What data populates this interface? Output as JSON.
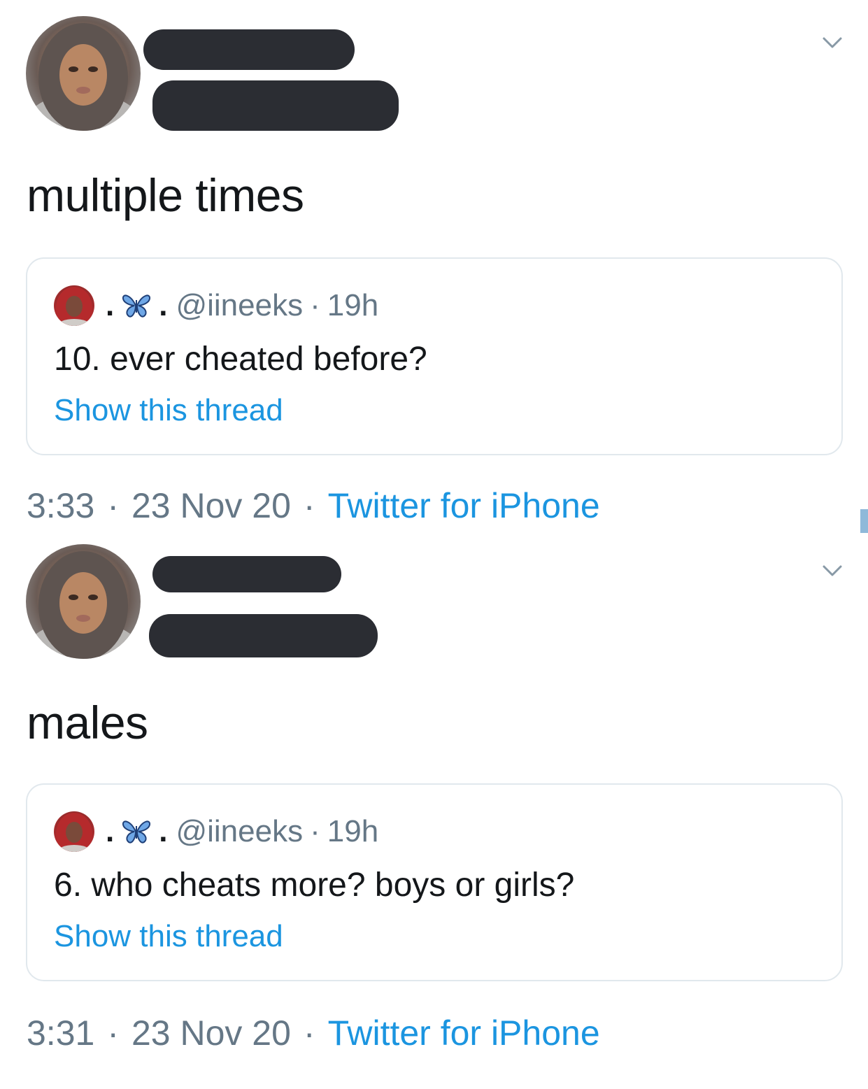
{
  "tweets": [
    {
      "text": "multiple times",
      "quoted": {
        "dot_left": ".",
        "dot_right": ".",
        "handle": "@iineeks",
        "separator": "·",
        "age": "19h",
        "body": "10. ever cheated before?",
        "link": "Show this thread"
      },
      "meta": {
        "time": "3:33",
        "date": "23 Nov 20",
        "separator": "·",
        "source": "Twitter for iPhone"
      }
    },
    {
      "text": "males",
      "quoted": {
        "dot_left": ".",
        "dot_right": ".",
        "handle": "@iineeks",
        "separator": "·",
        "age": "19h",
        "body": "6. who cheats more? boys or girls?",
        "link": "Show this thread"
      },
      "meta": {
        "time": "3:31",
        "date": "23 Nov 20",
        "separator": "·",
        "source": "Twitter for iPhone"
      }
    }
  ],
  "icons": {
    "menu": "chevron-down-icon",
    "emoji": "butterfly-icon"
  },
  "colors": {
    "text": "#14171a",
    "secondary": "#657786",
    "link": "#1b95e0",
    "border": "#e1e8ed",
    "redaction": "#2b2d33"
  }
}
